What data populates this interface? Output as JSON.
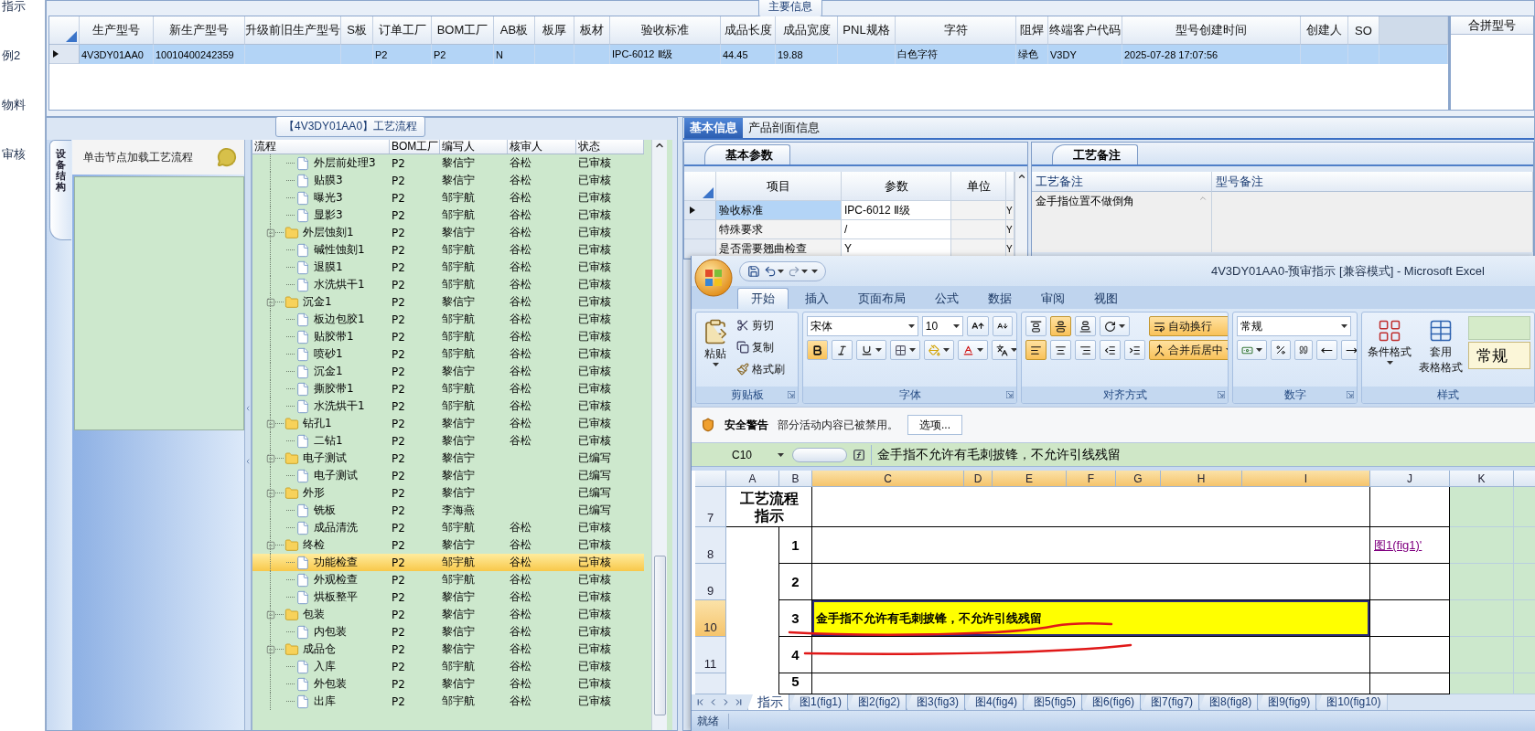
{
  "nav_fragments": [
    "指示",
    "例2",
    "物料",
    "审核"
  ],
  "main_info": {
    "title": "主要信息",
    "columns": [
      "生产型号",
      "新生产型号",
      "升级前旧生产型号",
      "S板",
      "订单工厂",
      "BOM工厂",
      "AB板",
      "板厚",
      "板材",
      "验收标准",
      "成品长度",
      "成品宽度",
      "PNL规格",
      "字符",
      "阻焊",
      "终端客户代码",
      "型号创建时间",
      "创建人",
      "SO"
    ],
    "rows": [
      {
        "selected": true,
        "cells": [
          "4V3DY01AA0",
          "10010400242359",
          null,
          null,
          "P2",
          "P2",
          "N",
          null,
          null,
          "IPC-6012 Ⅱ级",
          "44.45",
          "19.88",
          null,
          "白色字符",
          "绿色",
          "V3DY",
          "2025-07-28 17:07:56",
          null,
          null
        ]
      }
    ],
    "merge_panel_title": "合拼型号"
  },
  "process": {
    "title": "【4V3DY01AA0】工艺流程",
    "side_tab": "设备结构",
    "hint": "单击节点加载工艺流程",
    "columns": [
      "流程",
      "BOM工厂",
      "编写人",
      "核审人",
      "状态"
    ],
    "nodes": [
      {
        "kind": "file",
        "label": "外层前处理3",
        "factory": "P2",
        "author": "黎信宁",
        "reviewer": "谷松",
        "status": "已审核",
        "selected": false
      },
      {
        "kind": "file",
        "label": "贴膜3",
        "factory": "P2",
        "author": "黎信宁",
        "reviewer": "谷松",
        "status": "已审核",
        "selected": false
      },
      {
        "kind": "file",
        "label": "曝光3",
        "factory": "P2",
        "author": "邹宇航",
        "reviewer": "谷松",
        "status": "已审核",
        "selected": false
      },
      {
        "kind": "file",
        "label": "显影3",
        "factory": "P2",
        "author": "邹宇航",
        "reviewer": "谷松",
        "status": "已审核",
        "selected": false
      },
      {
        "kind": "folder",
        "label": "外层蚀刻1",
        "factory": "P2",
        "author": "黎信宁",
        "reviewer": "谷松",
        "status": "已审核",
        "selected": false,
        "expanded": true,
        "children": [
          {
            "kind": "file",
            "label": "碱性蚀刻1",
            "factory": "P2",
            "author": "邹宇航",
            "reviewer": "谷松",
            "status": "已审核",
            "selected": false
          },
          {
            "kind": "file",
            "label": "退膜1",
            "factory": "P2",
            "author": "邹宇航",
            "reviewer": "谷松",
            "status": "已审核",
            "selected": false
          },
          {
            "kind": "file",
            "label": "水洗烘干1",
            "factory": "P2",
            "author": "邹宇航",
            "reviewer": "谷松",
            "status": "已审核",
            "selected": false
          }
        ]
      },
      {
        "kind": "folder",
        "label": "沉金1",
        "factory": "P2",
        "author": "黎信宁",
        "reviewer": "谷松",
        "status": "已审核",
        "selected": false,
        "expanded": true,
        "children": [
          {
            "kind": "file",
            "label": "板边包胶1",
            "factory": "P2",
            "author": "邹宇航",
            "reviewer": "谷松",
            "status": "已审核",
            "selected": false
          },
          {
            "kind": "file",
            "label": "贴胶带1",
            "factory": "P2",
            "author": "邹宇航",
            "reviewer": "谷松",
            "status": "已审核",
            "selected": false
          },
          {
            "kind": "file",
            "label": "喷砂1",
            "factory": "P2",
            "author": "邹宇航",
            "reviewer": "谷松",
            "status": "已审核",
            "selected": false
          },
          {
            "kind": "file",
            "label": "沉金1",
            "factory": "P2",
            "author": "黎信宁",
            "reviewer": "谷松",
            "status": "已审核",
            "selected": false
          },
          {
            "kind": "file",
            "label": "撕胶带1",
            "factory": "P2",
            "author": "邹宇航",
            "reviewer": "谷松",
            "status": "已审核",
            "selected": false
          },
          {
            "kind": "file",
            "label": "水洗烘干1",
            "factory": "P2",
            "author": "邹宇航",
            "reviewer": "谷松",
            "status": "已审核",
            "selected": false
          }
        ]
      },
      {
        "kind": "folder",
        "label": "钻孔1",
        "factory": "P2",
        "author": "黎信宁",
        "reviewer": "谷松",
        "status": "已审核",
        "selected": false,
        "expanded": true,
        "children": [
          {
            "kind": "file",
            "label": "二钻1",
            "factory": "P2",
            "author": "黎信宁",
            "reviewer": "谷松",
            "status": "已审核",
            "selected": false
          }
        ]
      },
      {
        "kind": "folder",
        "label": "电子测试",
        "factory": "P2",
        "author": "黎信宁",
        "status": "已编写",
        "selected": false,
        "expanded": true,
        "children": [
          {
            "kind": "file",
            "label": "电子测试",
            "factory": "P2",
            "author": "黎信宁",
            "status": "已编写",
            "selected": false
          }
        ]
      },
      {
        "kind": "folder",
        "label": "外形",
        "factory": "P2",
        "author": "黎信宁",
        "status": "已编写",
        "selected": false,
        "expanded": true,
        "children": [
          {
            "kind": "file",
            "label": "铣板",
            "factory": "P2",
            "author": "李海燕",
            "status": "已编写",
            "selected": false
          },
          {
            "kind": "file",
            "label": "成品清洗",
            "factory": "P2",
            "author": "邹宇航",
            "reviewer": "谷松",
            "status": "已审核",
            "selected": false
          }
        ]
      },
      {
        "kind": "folder",
        "label": "终检",
        "factory": "P2",
        "author": "黎信宁",
        "reviewer": "谷松",
        "status": "已审核",
        "selected": false,
        "expanded": true,
        "children": [
          {
            "kind": "file",
            "label": "功能检查",
            "factory": "P2",
            "author": "邹宇航",
            "reviewer": "谷松",
            "status": "已审核",
            "selected": true
          },
          {
            "kind": "file",
            "label": "外观检查",
            "factory": "P2",
            "author": "邹宇航",
            "reviewer": "谷松",
            "status": "已审核",
            "selected": false
          },
          {
            "kind": "file",
            "label": "烘板整平",
            "factory": "P2",
            "author": "黎信宁",
            "reviewer": "谷松",
            "status": "已审核",
            "selected": false
          }
        ]
      },
      {
        "kind": "folder",
        "label": "包装",
        "factory": "P2",
        "author": "黎信宁",
        "reviewer": "谷松",
        "status": "已审核",
        "selected": false,
        "expanded": true,
        "children": [
          {
            "kind": "file",
            "label": "内包装",
            "factory": "P2",
            "author": "黎信宁",
            "reviewer": "谷松",
            "status": "已审核",
            "selected": false
          }
        ]
      },
      {
        "kind": "folder",
        "label": "成品仓",
        "factory": "P2",
        "author": "黎信宁",
        "reviewer": "谷松",
        "status": "已审核",
        "selected": false,
        "expanded": true,
        "children": [
          {
            "kind": "file",
            "label": "入库",
            "factory": "P2",
            "author": "邹宇航",
            "reviewer": "谷松",
            "status": "已审核",
            "selected": false
          },
          {
            "kind": "file",
            "label": "外包装",
            "factory": "P2",
            "author": "黎信宁",
            "reviewer": "谷松",
            "status": "已审核",
            "selected": false
          },
          {
            "kind": "file",
            "label": "出库",
            "factory": "P2",
            "author": "邹宇航",
            "reviewer": "谷松",
            "status": "已审核",
            "selected": false
          }
        ]
      }
    ]
  },
  "detail": {
    "tabs": [
      {
        "label": "基本信息",
        "selected": true
      },
      {
        "label": "产品剖面信息",
        "selected": false
      }
    ],
    "params": {
      "tab": "基本参数",
      "columns": [
        "项目",
        "参数",
        "单位"
      ],
      "rows": [
        {
          "item": "验收标准",
          "value": "IPC-6012 Ⅱ级",
          "flag": "Y",
          "selected": true
        },
        {
          "item": "特殊要求",
          "value": "/",
          "flag": "Y",
          "selected": false
        },
        {
          "item": "是否需要翘曲检查",
          "value": "Y",
          "flag": "Y",
          "selected": false
        }
      ]
    },
    "notes": {
      "tab": "工艺备注",
      "columns": [
        "工艺备注",
        "型号备注"
      ],
      "process_note": "金手指位置不做倒角"
    }
  },
  "excel": {
    "title": "4V3DY01AA0-预审指示 [兼容模式] - Microsoft Excel",
    "tabs": [
      {
        "label": "开始",
        "selected": true
      },
      {
        "label": "插入",
        "selected": false
      },
      {
        "label": "页面布局",
        "selected": false
      },
      {
        "label": "公式",
        "selected": false
      },
      {
        "label": "数据",
        "selected": false
      },
      {
        "label": "审阅",
        "selected": false
      },
      {
        "label": "视图",
        "selected": false
      }
    ],
    "clipboard": {
      "label": "剪贴板",
      "paste": "粘贴",
      "cut": "剪切",
      "copy": "复制",
      "painter": "格式刷"
    },
    "font": {
      "label": "字体",
      "name": "宋体",
      "size": "10"
    },
    "alignment": {
      "label": "对齐方式",
      "vertical": [
        {
          "kind": "top",
          "selected": false
        },
        {
          "kind": "middle",
          "selected": true
        },
        {
          "kind": "bottom",
          "selected": false
        }
      ],
      "horizontal": [
        {
          "kind": "left",
          "selected": true
        },
        {
          "kind": "center",
          "selected": false
        },
        {
          "kind": "right",
          "selected": false
        }
      ],
      "wrap": {
        "label": "自动换行",
        "on": true
      },
      "merge": {
        "label": "合并后居中",
        "on": true
      }
    },
    "number": {
      "label": "数字",
      "format": "常规"
    },
    "styles": {
      "label": "样式",
      "conditional": "条件格式",
      "table_format": [
        "套用",
        "表格格式"
      ],
      "gallery": "常规"
    },
    "security": {
      "title": "安全警告",
      "message": "部分活动内容已被禁用。",
      "button": "选项..."
    },
    "formula": {
      "cell": "C10",
      "text": "金手指不允许有毛刺披锋，不允许引线残留"
    },
    "sheet": {
      "columns": [
        {
          "label": "A",
          "selected": false
        },
        {
          "label": "B",
          "selected": false
        },
        {
          "label": "C",
          "selected": true
        },
        {
          "label": "D",
          "selected": true
        },
        {
          "label": "E",
          "selected": true
        },
        {
          "label": "F",
          "selected": true
        },
        {
          "label": "G",
          "selected": true
        },
        {
          "label": "H",
          "selected": true
        },
        {
          "label": "I",
          "selected": true
        },
        {
          "label": "J",
          "selected": false
        },
        {
          "label": "K",
          "selected": false
        }
      ],
      "rows": [
        {
          "kind": "title",
          "label": "7",
          "selected": false,
          "title": [
            "工艺流程",
            "指示"
          ]
        },
        {
          "kind": "step",
          "label": "8",
          "selected": false,
          "number": "1",
          "link": "图1(fig1)'"
        },
        {
          "kind": "step",
          "label": "9",
          "selected": false,
          "number": "2"
        },
        {
          "kind": "step",
          "label": "10",
          "selected": true,
          "number": "3",
          "text": "金手指不允许有毛刺披锋，不允许引线残留",
          "color": "#ffff00"
        },
        {
          "kind": "step",
          "label": "11",
          "selected": false,
          "number": "4"
        },
        {
          "kind": "step",
          "selected": false,
          "number": "5"
        }
      ]
    },
    "sheet_tabs": [
      {
        "label": "指示",
        "selected": true
      },
      {
        "label": "图1(fig1)",
        "selected": false
      },
      {
        "label": "图2(fig2)",
        "selected": false
      },
      {
        "label": "图3(fig3)",
        "selected": false
      },
      {
        "label": "图4(fig4)",
        "selected": false
      },
      {
        "label": "图5(fig5)",
        "selected": false
      },
      {
        "label": "图6(fig6)",
        "selected": false
      },
      {
        "label": "图7(fig7)",
        "selected": false
      },
      {
        "label": "图8(fig8)",
        "selected": false
      },
      {
        "label": "图9(fig9)",
        "selected": false
      },
      {
        "label": "图10(fig10)",
        "selected": false
      }
    ],
    "status": "就绪"
  }
}
